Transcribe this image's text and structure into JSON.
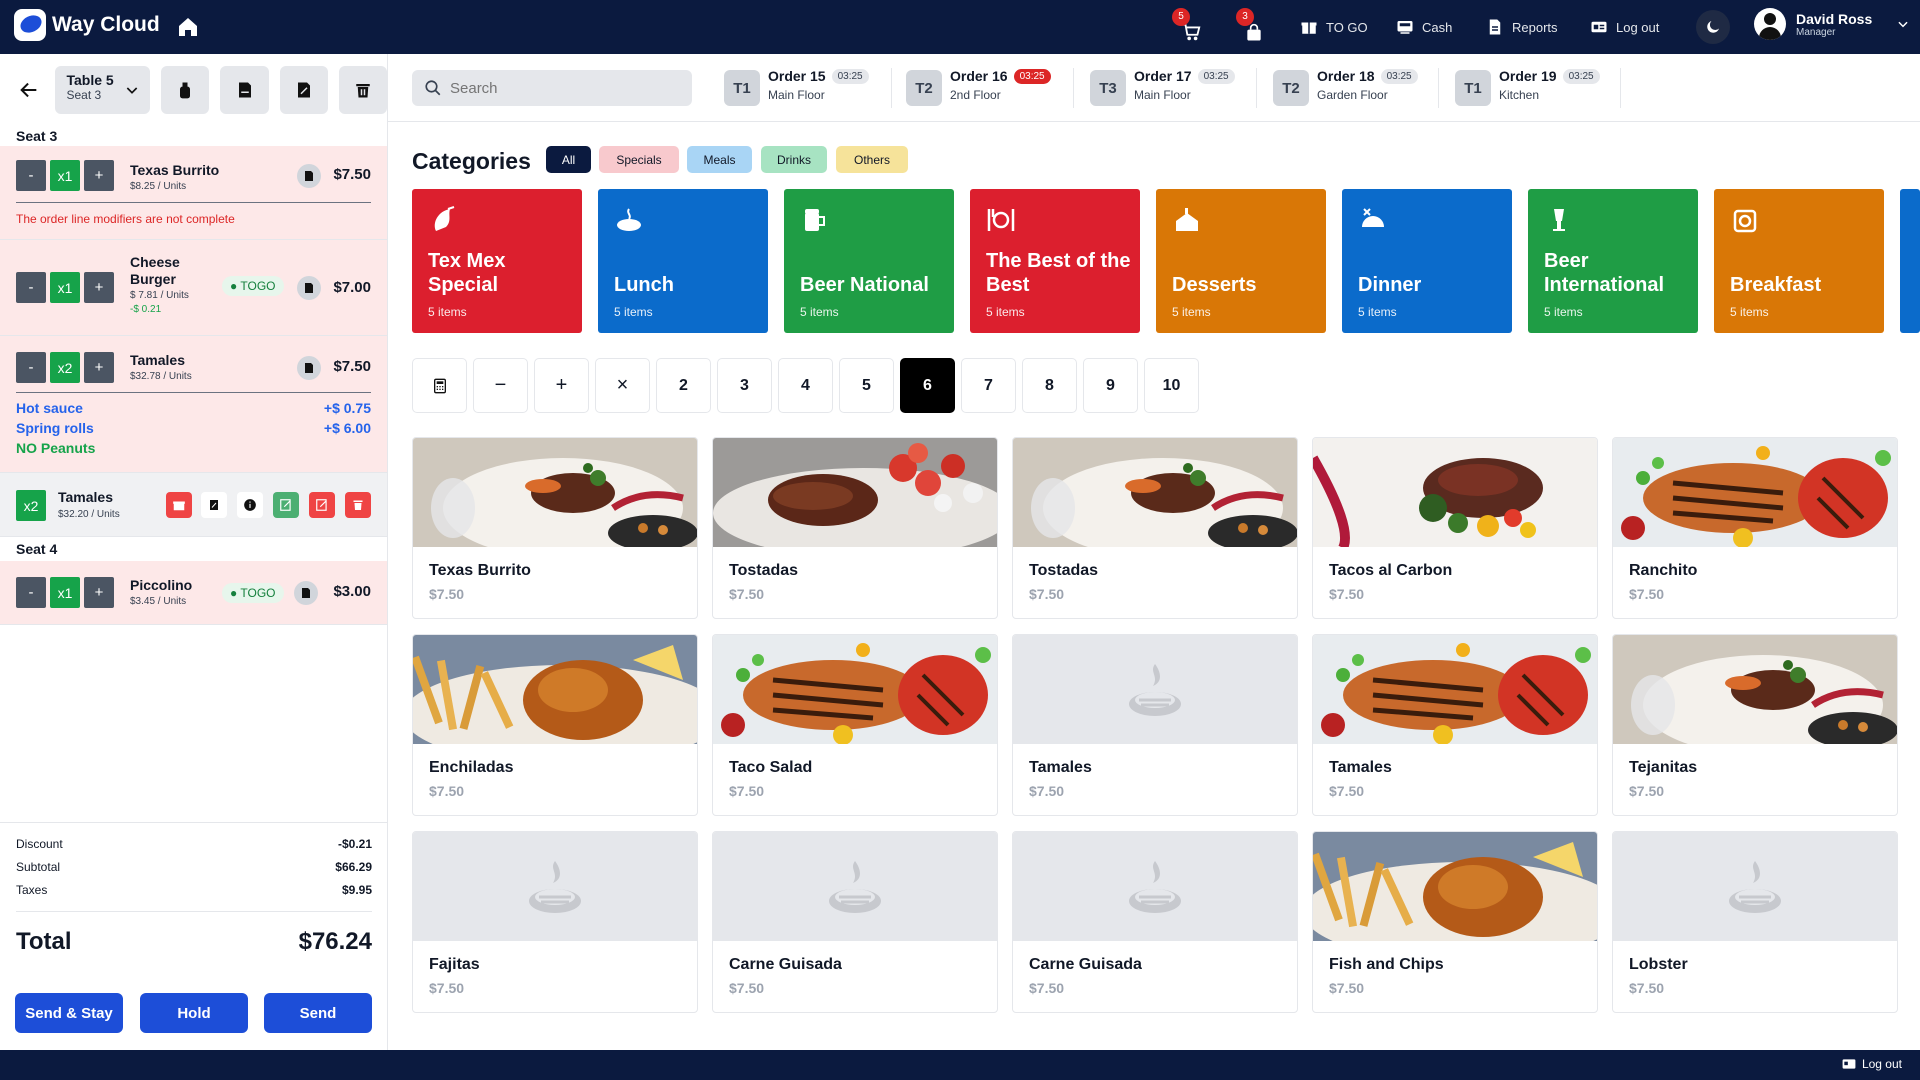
{
  "brand": {
    "name": "Way Cloud"
  },
  "topnav": {
    "cart_badge": "5",
    "bag_badge": "3",
    "togo": "TO GO",
    "cash": "Cash",
    "reports": "Reports",
    "logout": "Log out"
  },
  "user": {
    "name": "David Ross",
    "role": "Manager"
  },
  "order_panel": {
    "table": "Table 5",
    "seat": "Seat 3",
    "seat3_title": "Seat 3",
    "seat4_title": "Seat 4",
    "lines": [
      {
        "qty": "x1",
        "name": "Texas Burrito",
        "unit": "$8.25 / Units",
        "price": "$7.50",
        "error": "The order line modifiers are not complete"
      },
      {
        "qty": "x1",
        "name": "Cheese Burger",
        "unit": "$ 7.81 / Units",
        "discount": "-$ 0.21",
        "togo": "TOGO",
        "price": "$7.00"
      },
      {
        "qty": "x2",
        "name": "Tamales",
        "unit": "$32.78 / Units",
        "price": "$7.50",
        "modifiers": [
          {
            "name": "Hot sauce",
            "price": "+$ 0.75"
          },
          {
            "name": "Spring rolls",
            "price": "+$ 6.00"
          },
          {
            "name": "NO Peanuts",
            "price": ""
          }
        ]
      },
      {
        "qty": "x2",
        "name": "Tamales",
        "unit": "$32.20 / Units"
      },
      {
        "qty": "x1",
        "name": "Piccolino",
        "unit": "$3.45 / Units",
        "togo": "TOGO",
        "price": "$3.00"
      }
    ],
    "minus": "-",
    "plus": "+",
    "discount_label": "Discount",
    "discount": "-$0.21",
    "subtotal_label": "Subtotal",
    "subtotal": "$66.29",
    "taxes_label": "Taxes",
    "taxes": "$9.95",
    "total_label": "Total",
    "total": "$76.24",
    "btn_send_stay": "Send & Stay",
    "btn_hold": "Hold",
    "btn_send": "Send"
  },
  "search": {
    "placeholder": "Search"
  },
  "orders": [
    {
      "tag": "T1",
      "name": "Order 15",
      "time": "03:25",
      "floor": "Main Floor",
      "alert": false
    },
    {
      "tag": "T2",
      "name": "Order 16",
      "time": "03:25",
      "floor": "2nd Floor",
      "alert": true
    },
    {
      "tag": "T3",
      "name": "Order 17",
      "time": "03:25",
      "floor": "Main Floor",
      "alert": false
    },
    {
      "tag": "T2",
      "name": "Order 18",
      "time": "03:25",
      "floor": "Garden Floor",
      "alert": false
    },
    {
      "tag": "T1",
      "name": "Order 19",
      "time": "03:25",
      "floor": "Kitchen",
      "alert": false
    }
  ],
  "categories_title": "Categories",
  "filters": [
    "All",
    "Specials",
    "Meals",
    "Drinks",
    "Others"
  ],
  "categories": [
    {
      "name": "Tex Mex Special",
      "count": "5 items",
      "color": "#dc1f2e"
    },
    {
      "name": "Lunch",
      "count": "5 items",
      "color": "#0b6bcb"
    },
    {
      "name": "Beer National",
      "count": "5 items",
      "color": "#1f9d45"
    },
    {
      "name": "The Best of the Best",
      "count": "5 items",
      "color": "#dc1f2e"
    },
    {
      "name": "Desserts",
      "count": "5 items",
      "color": "#d97706"
    },
    {
      "name": "Dinner",
      "count": "5 items",
      "color": "#0b6bcb"
    },
    {
      "name": "Beer International",
      "count": "5 items",
      "color": "#1f9d45"
    },
    {
      "name": "Breakfast",
      "count": "5 items",
      "color": "#d97706"
    }
  ],
  "quantity_pad": {
    "minus": "−",
    "plus": "+",
    "times": "×",
    "numbers": [
      "2",
      "3",
      "4",
      "5",
      "6",
      "7",
      "8",
      "9",
      "10"
    ],
    "selected": "6"
  },
  "products": [
    {
      "name": "Texas Burrito",
      "price": "$7.50",
      "image": "steak-plate"
    },
    {
      "name": "Tostadas",
      "price": "$7.50",
      "image": "steak-tomato"
    },
    {
      "name": "Tostadas",
      "price": "$7.50",
      "image": "steak-plate"
    },
    {
      "name": "Tacos al Carbon",
      "price": "$7.50",
      "image": "steak-greens"
    },
    {
      "name": "Ranchito",
      "price": "$7.50",
      "image": "grilled-fish"
    },
    {
      "name": "Enchiladas",
      "price": "$7.50",
      "image": "chicken-fries"
    },
    {
      "name": "Taco Salad",
      "price": "$7.50",
      "image": "grilled-fish"
    },
    {
      "name": "Tamales",
      "price": "$7.50",
      "image": "placeholder"
    },
    {
      "name": "Tamales",
      "price": "$7.50",
      "image": "grilled-fish"
    },
    {
      "name": "Tejanitas",
      "price": "$7.50",
      "image": "steak-plate"
    },
    {
      "name": "Fajitas",
      "price": "$7.50",
      "image": "placeholder"
    },
    {
      "name": "Carne Guisada",
      "price": "$7.50",
      "image": "placeholder"
    },
    {
      "name": "Carne Guisada",
      "price": "$7.50",
      "image": "placeholder"
    },
    {
      "name": "Fish and Chips",
      "price": "$7.50",
      "image": "chicken-fries"
    },
    {
      "name": "Lobster",
      "price": "$7.50",
      "image": "placeholder"
    }
  ],
  "footer": {
    "logout": "Log out"
  }
}
